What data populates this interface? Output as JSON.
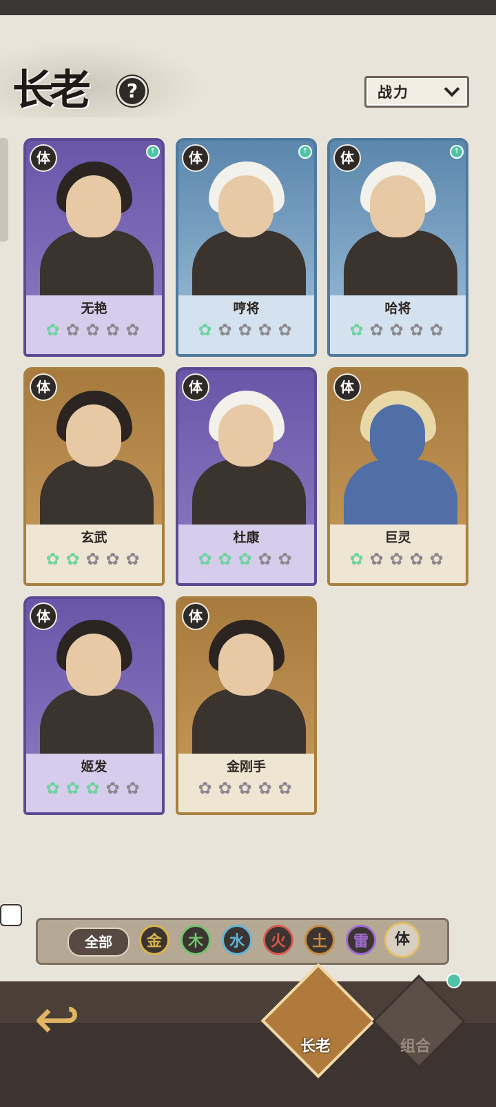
{
  "header": {
    "title": "长老",
    "help_icon": "?",
    "sort": {
      "selected": "战力"
    }
  },
  "cards": [
    {
      "name": "无艳",
      "attr": "体",
      "frame": "purple",
      "stars": 1,
      "upgrade": true
    },
    {
      "name": "哼将",
      "attr": "体",
      "frame": "blue",
      "stars": 1,
      "upgrade": true
    },
    {
      "name": "哈将",
      "attr": "体",
      "frame": "blue",
      "stars": 1,
      "upgrade": true
    },
    {
      "name": "玄武",
      "attr": "体",
      "frame": "gold",
      "stars": 2,
      "upgrade": false
    },
    {
      "name": "杜康",
      "attr": "体",
      "frame": "purple",
      "stars": 3,
      "upgrade": false
    },
    {
      "name": "巨灵",
      "attr": "体",
      "frame": "gold",
      "stars": 1,
      "upgrade": false
    },
    {
      "name": "姬发",
      "attr": "体",
      "frame": "purple",
      "stars": 3,
      "upgrade": false
    },
    {
      "name": "金刚手",
      "attr": "体",
      "frame": "gold",
      "stars": 0,
      "upgrade": false
    }
  ],
  "filters": {
    "all": "全部",
    "elements": [
      {
        "label": "金",
        "color": "#d9b44a"
      },
      {
        "label": "木",
        "color": "#6fc46b"
      },
      {
        "label": "水",
        "color": "#5eb6d6"
      },
      {
        "label": "火",
        "color": "#d85a4a"
      },
      {
        "label": "土",
        "color": "#c98a3a"
      },
      {
        "label": "雷",
        "color": "#a06ad0"
      },
      {
        "label": "体",
        "color": "#e3c063",
        "selected": true
      }
    ]
  },
  "nav": {
    "elder": "长老",
    "combo": "组合"
  }
}
